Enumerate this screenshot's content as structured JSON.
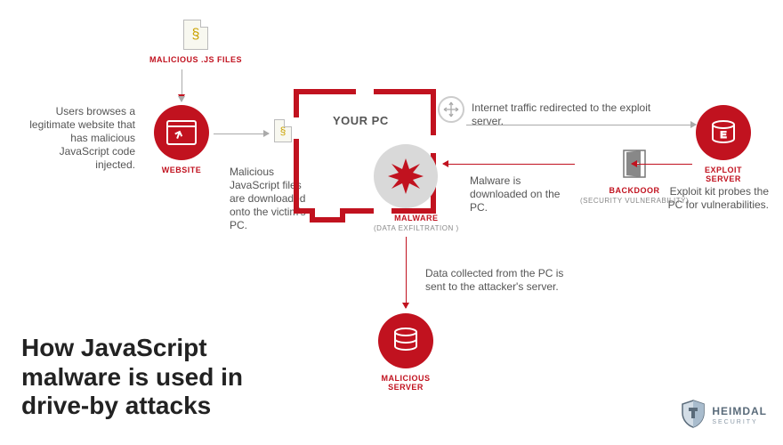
{
  "title": "How JavaScript malware is used in drive-by attacks",
  "nodes": {
    "js_files": {
      "label": "MALICIOUS .JS FILES"
    },
    "website": {
      "label": "WEBSITE"
    },
    "your_pc": {
      "label": "YOUR PC"
    },
    "malware": {
      "label": "MALWARE",
      "sublabel": "(DATA EXFILTRATION )"
    },
    "backdoor": {
      "label": "BACKDOOR",
      "sublabel": "(SECURITY VULNERABILITY)"
    },
    "exploit_server": {
      "label": "EXPLOIT SERVER"
    },
    "malicious_server": {
      "label": "MALICIOUS SERVER"
    }
  },
  "descriptions": {
    "browse": "Users browses a legitimate website that has malicious JavaScript code injected.",
    "download_js": "Malicious JavaScript files are downloaded onto the victim's PC.",
    "redirect": "Internet traffic redirected to the exploit server.",
    "malware_dl": "Malware is downloaded on the PC.",
    "exploit_probe": "Exploit kit probes the PC for vulnerabilities.",
    "exfil": "Data collected from the PC is sent to the attacker's server."
  },
  "brand": "HEIMDAL",
  "colors": {
    "accent": "#c1121f",
    "grey": "#888"
  }
}
